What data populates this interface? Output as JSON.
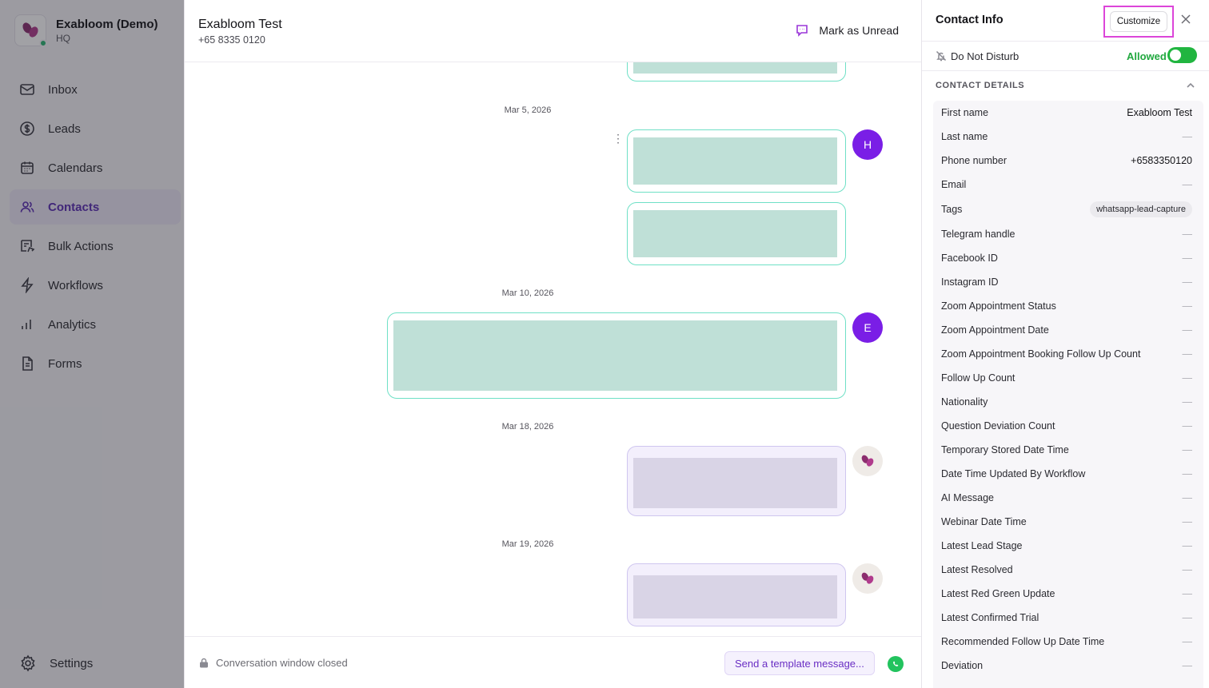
{
  "app": {
    "org_name": "Exabloom (Demo)",
    "org_sub": "HQ"
  },
  "sidebar": {
    "items": [
      {
        "label": "Inbox",
        "icon": "mail-icon"
      },
      {
        "label": "Leads",
        "icon": "dollar-icon"
      },
      {
        "label": "Calendars",
        "icon": "calendar-icon"
      },
      {
        "label": "Contacts",
        "icon": "users-icon",
        "active": true
      },
      {
        "label": "Bulk Actions",
        "icon": "bulk-actions-icon"
      },
      {
        "label": "Workflows",
        "icon": "lightning-icon"
      },
      {
        "label": "Analytics",
        "icon": "bar-chart-icon"
      },
      {
        "label": "Forms",
        "icon": "document-icon"
      }
    ],
    "settings_label": "Settings"
  },
  "chat": {
    "contact_name": "Exabloom Test",
    "contact_phone": "+65 8335 0120",
    "mark_unread_label": "Mark as Unread",
    "dates": [
      "Mar 5, 2026",
      "Mar 10, 2026",
      "Mar 18, 2026",
      "Mar 19, 2026"
    ],
    "avatars": [
      "H",
      "E"
    ],
    "footer_status": "Conversation window closed",
    "template_button": "Send a template message..."
  },
  "info": {
    "title": "Contact Info",
    "customize_label": "Customize",
    "dnd_label": "Do Not Disturb",
    "dnd_status": "Allowed",
    "section_title": "CONTACT DETAILS",
    "fields": [
      {
        "key": "First name",
        "value": "Exabloom Test"
      },
      {
        "key": "Last name",
        "value": "—"
      },
      {
        "key": "Phone number",
        "value": "+6583350120"
      },
      {
        "key": "Email",
        "value": "—"
      },
      {
        "key": "Tags",
        "value": "whatsapp-lead-capture"
      },
      {
        "key": "Telegram handle",
        "value": "—"
      },
      {
        "key": "Facebook ID",
        "value": "—"
      },
      {
        "key": "Instagram ID",
        "value": "—"
      },
      {
        "key": "Zoom Appointment Status",
        "value": "—"
      },
      {
        "key": "Zoom Appointment Date",
        "value": "—"
      },
      {
        "key": "Zoom Appointment Booking Follow Up Count",
        "value": "—"
      },
      {
        "key": "Follow Up Count",
        "value": "—"
      },
      {
        "key": "Nationality",
        "value": "—"
      },
      {
        "key": "Question Deviation Count",
        "value": "—"
      },
      {
        "key": "Temporary Stored Date Time",
        "value": "—"
      },
      {
        "key": "Date Time Updated By Workflow",
        "value": "—"
      },
      {
        "key": "AI Message",
        "value": "—"
      },
      {
        "key": "Webinar Date Time",
        "value": "—"
      },
      {
        "key": "Latest Lead Stage",
        "value": "—"
      },
      {
        "key": "Latest Resolved",
        "value": "—"
      },
      {
        "key": "Latest Red Green Update",
        "value": "—"
      },
      {
        "key": "Latest Confirmed Trial",
        "value": "—"
      },
      {
        "key": "Recommended Follow Up Date Time",
        "value": "—"
      },
      {
        "key": "Deviation",
        "value": "—"
      }
    ]
  },
  "colors": {
    "accent": "#5b2db3",
    "avatar_purple": "#7a1ee6",
    "allowed_green": "#21a83f",
    "customize_highlight": "#dc45d9"
  }
}
